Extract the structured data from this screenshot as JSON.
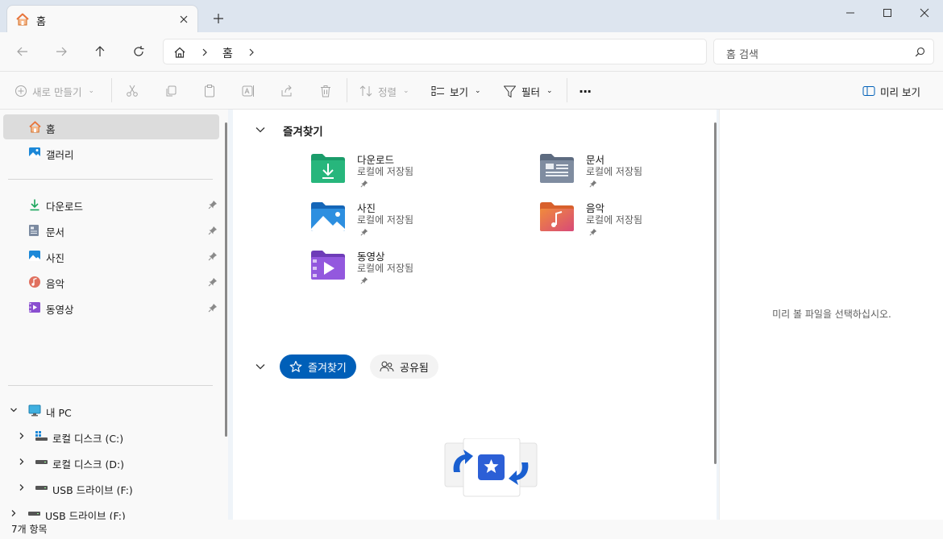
{
  "titlebar": {
    "tab_label": "홈"
  },
  "addressbar": {
    "breadcrumb": "홈",
    "search_placeholder": "홈 검색"
  },
  "commandbar": {
    "new_label": "새로 만들기",
    "sort_label": "정렬",
    "view_label": "보기",
    "filter_label": "필터",
    "more_label": "···",
    "preview_label": "미리 보기"
  },
  "sidebar": {
    "top_items": [
      {
        "label": "홈",
        "icon": "home-icon"
      },
      {
        "label": "갤러리",
        "icon": "gallery-icon"
      }
    ],
    "pinned_items": [
      {
        "label": "다운로드",
        "icon": "download-icon"
      },
      {
        "label": "문서",
        "icon": "document-icon"
      },
      {
        "label": "사진",
        "icon": "pictures-icon"
      },
      {
        "label": "음악",
        "icon": "music-icon"
      },
      {
        "label": "동영상",
        "icon": "video-icon"
      }
    ],
    "tree_items": [
      {
        "label": "내 PC",
        "icon": "pc-icon"
      },
      {
        "label": "로컬 디스크 (C:)",
        "icon": "windows-drive-icon"
      },
      {
        "label": "로컬 디스크 (D:)",
        "icon": "drive-icon"
      },
      {
        "label": "USB 드라이브 (F:)",
        "icon": "usb-drive-icon"
      },
      {
        "label": "USB 드라이브 (F:)",
        "icon": "usb-drive-icon"
      }
    ]
  },
  "main": {
    "quick_access_title": "즐겨찾기",
    "quick_access": [
      {
        "name": "다운로드",
        "sub": "로컬에 저장됨",
        "icon": "download-folder-icon"
      },
      {
        "name": "문서",
        "sub": "로컬에 저장됨",
        "icon": "documents-folder-icon"
      },
      {
        "name": "사진",
        "sub": "로컬에 저장됨",
        "icon": "pictures-folder-icon"
      },
      {
        "name": "음악",
        "sub": "로컬에 저장됨",
        "icon": "music-folder-icon"
      },
      {
        "name": "동영상",
        "sub": "로컬에 저장됨",
        "icon": "videos-folder-icon"
      }
    ],
    "pills": {
      "favorites": "즐겨찾기",
      "shared": "공유됨"
    }
  },
  "preview": {
    "message": "미리 볼 파일을 선택하십시오."
  },
  "status": {
    "item_count": "7개 항목"
  },
  "colors": {
    "accent": "#005fb8",
    "titlebar": "#dde5ef",
    "selection": "#dcdcdc"
  }
}
